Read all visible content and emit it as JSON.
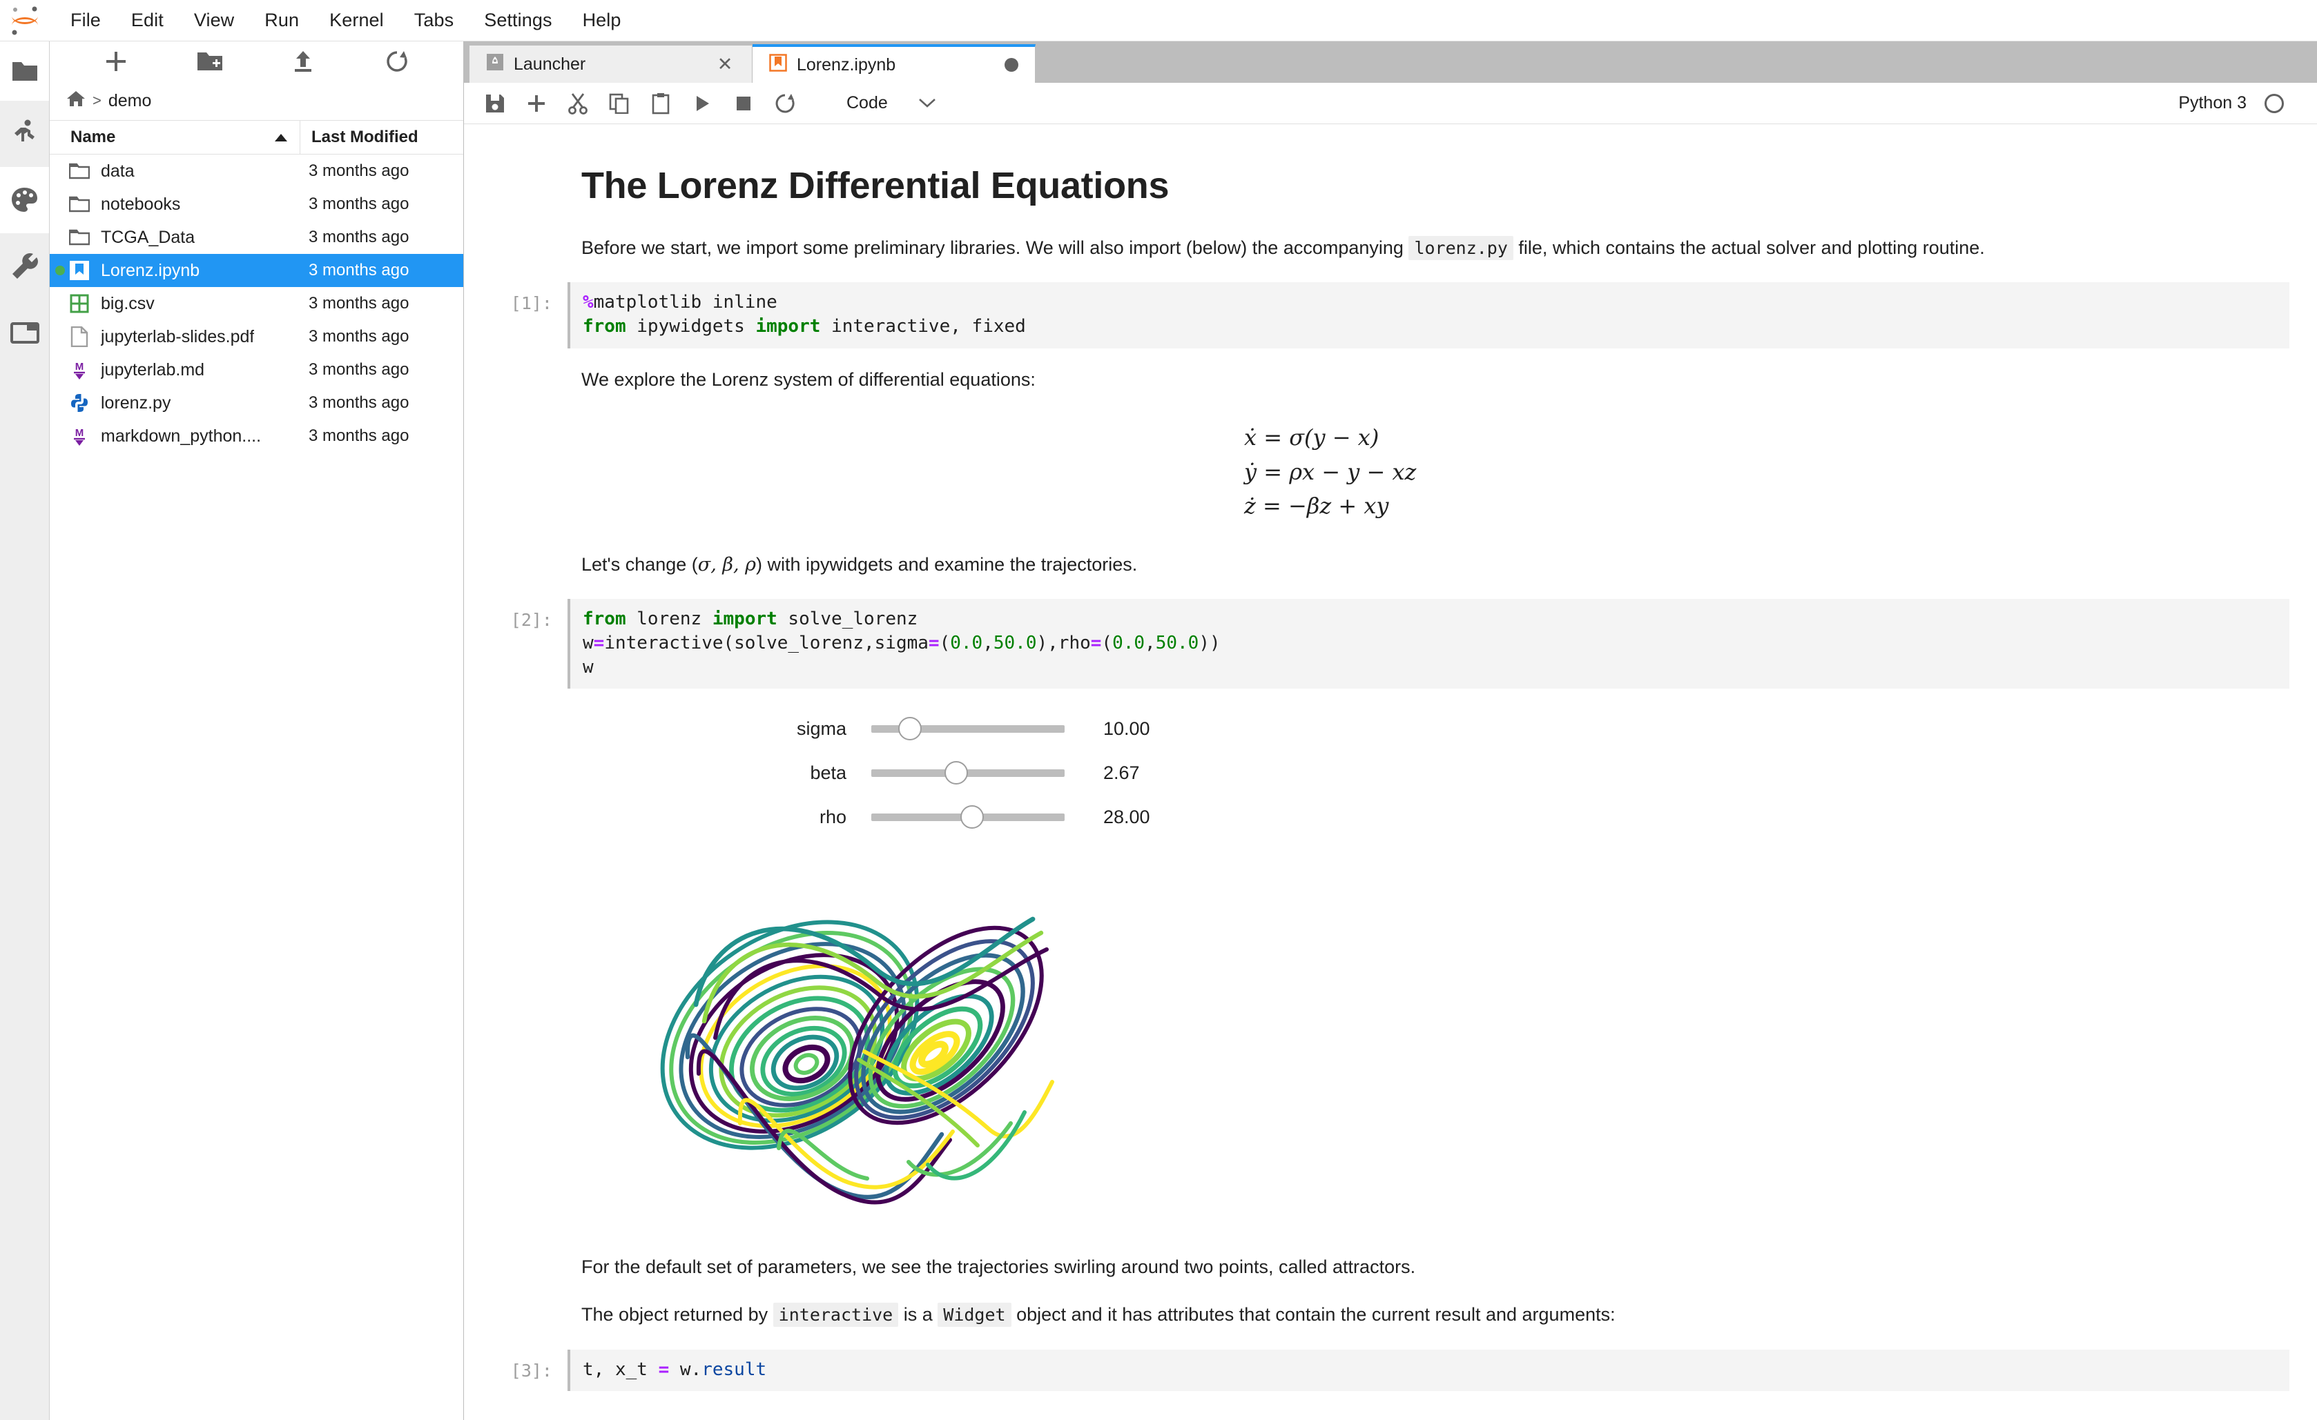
{
  "app": {
    "title": "JupyterLab",
    "logo_icon": "jupyter-logo-icon"
  },
  "menubar": {
    "items": [
      {
        "label": "File"
      },
      {
        "label": "Edit"
      },
      {
        "label": "View"
      },
      {
        "label": "Run"
      },
      {
        "label": "Kernel"
      },
      {
        "label": "Tabs"
      },
      {
        "label": "Settings"
      },
      {
        "label": "Help"
      }
    ]
  },
  "activitybar": {
    "items": [
      {
        "name": "file-browser-icon",
        "tooltip": "File Browser",
        "active": false
      },
      {
        "name": "running-sessions-icon",
        "tooltip": "Running Terminals and Kernels",
        "active": true
      },
      {
        "name": "palette-icon",
        "tooltip": "Extension Manager",
        "active": false
      },
      {
        "name": "wrench-icon",
        "tooltip": "Property Inspector",
        "active": false
      },
      {
        "name": "open-tabs-icon",
        "tooltip": "Open Tabs",
        "active": false
      }
    ]
  },
  "filebrowser": {
    "toolbar": [
      {
        "name": "new-launcher-icon",
        "label": "New Launcher"
      },
      {
        "name": "new-folder-icon",
        "label": "New Folder"
      },
      {
        "name": "upload-icon",
        "label": "Upload Files"
      },
      {
        "name": "refresh-icon",
        "label": "Refresh File List"
      }
    ],
    "breadcrumb": {
      "home_icon": "home-icon",
      "separator": ">",
      "path": "demo"
    },
    "columns": {
      "name": "Name",
      "last_modified": "Last Modified",
      "sort_direction": "ascending"
    },
    "items": [
      {
        "name": "data",
        "modified": "3 months ago",
        "icon": "folder-icon",
        "type": "folder",
        "selected": false,
        "running": false
      },
      {
        "name": "notebooks",
        "modified": "3 months ago",
        "icon": "folder-icon",
        "type": "folder",
        "selected": false,
        "running": false
      },
      {
        "name": "TCGA_Data",
        "modified": "3 months ago",
        "icon": "folder-icon",
        "type": "folder",
        "selected": false,
        "running": false
      },
      {
        "name": "Lorenz.ipynb",
        "modified": "3 months ago",
        "icon": "notebook-icon",
        "type": "notebook",
        "selected": true,
        "running": true
      },
      {
        "name": "big.csv",
        "modified": "3 months ago",
        "icon": "spreadsheet-icon",
        "type": "csv",
        "selected": false,
        "running": false
      },
      {
        "name": "jupyterlab-slides.pdf",
        "modified": "3 months ago",
        "icon": "pdf-file-icon",
        "type": "pdf",
        "selected": false,
        "running": false
      },
      {
        "name": "jupyterlab.md",
        "modified": "3 months ago",
        "icon": "markdown-icon",
        "type": "markdown",
        "selected": false,
        "running": false
      },
      {
        "name": "lorenz.py",
        "modified": "3 months ago",
        "icon": "python-icon",
        "type": "python",
        "selected": false,
        "running": false
      },
      {
        "name": "markdown_python....",
        "modified": "3 months ago",
        "icon": "markdown-icon",
        "type": "markdown",
        "selected": false,
        "running": false
      }
    ]
  },
  "dock": {
    "tabs": [
      {
        "label": "Launcher",
        "icon": "launcher-icon",
        "active": false,
        "dirty": false,
        "close_glyph": "✕"
      },
      {
        "label": "Lorenz.ipynb",
        "icon": "notebook-icon",
        "active": true,
        "dirty": true,
        "close_glyph": ""
      }
    ]
  },
  "notebook_toolbar": {
    "buttons": [
      {
        "name": "save-icon",
        "label": "Save"
      },
      {
        "name": "insert-cell-icon",
        "label": "Insert Cell Below"
      },
      {
        "name": "cut-icon",
        "label": "Cut Cells"
      },
      {
        "name": "copy-icon",
        "label": "Copy Cells"
      },
      {
        "name": "paste-icon",
        "label": "Paste Cells"
      },
      {
        "name": "run-icon",
        "label": "Run Cells"
      },
      {
        "name": "stop-icon",
        "label": "Interrupt Kernel"
      },
      {
        "name": "restart-icon",
        "label": "Restart Kernel"
      }
    ],
    "cell_type": {
      "value": "Code",
      "chevron": "chevron-down-icon"
    },
    "kernel": {
      "name": "Python 3",
      "status_icon": "kernel-idle-circle"
    }
  },
  "notebook": {
    "title": "The Lorenz Differential Equations",
    "intro": {
      "before": "Before we start, we import some preliminary libraries. We will also import (below) the accompanying ",
      "code": "lorenz.py",
      "after": " file, which contains the actual solver and plotting routine."
    },
    "cell1": {
      "prompt": "[1]:",
      "line1_magic": "%",
      "line1_rest": "matplotlib inline",
      "line2_kw1": "from",
      "line2_mid": " ipywidgets ",
      "line2_kw2": "import",
      "line2_end": " interactive, fixed"
    },
    "explore_text": "We explore the Lorenz system of differential equations:",
    "equations": [
      "ẋ = σ(y − x)",
      "ẏ = ρx − y − xz",
      "ż = −βz + xy"
    ],
    "change_text_a": "Let's change (",
    "change_params": "σ, β, ρ",
    "change_text_b": ") with ipywidgets and examine the trajectories.",
    "cell2": {
      "prompt": "[2]:",
      "l1_kw1": "from",
      "l1_mid": " lorenz ",
      "l1_kw2": "import",
      "l1_end": " solve_lorenz",
      "l2_a": "w",
      "l2_eq1": "=",
      "l2_b": "interactive(solve_lorenz,sigma",
      "l2_eq2": "=",
      "l2_c": "(",
      "l2_n1": "0.0",
      "l2_d": ",",
      "l2_n2": "50.0",
      "l2_e": "),rho",
      "l2_eq3": "=",
      "l2_f": "(",
      "l2_n3": "0.0",
      "l2_g": ",",
      "l2_n4": "50.0",
      "l2_h": "))",
      "l3": "w"
    },
    "widgets": [
      {
        "label": "sigma",
        "value": "10.00",
        "fill_pct": 20,
        "min": 0.0,
        "max": 50.0
      },
      {
        "label": "beta",
        "value": "2.67",
        "fill_pct": 44,
        "min": 0.0,
        "max": 6.0
      },
      {
        "label": "rho",
        "value": "28.00",
        "fill_pct": 52,
        "min": 0.0,
        "max": 50.0
      }
    ],
    "plot": {
      "name": "lorenz-attractor-plot",
      "colormap": "viridis",
      "description": "Lorenz attractor trajectories"
    },
    "attractor_text": "For the default set of parameters, we see the trajectories swirling around two points, called attractors.",
    "widget_text": {
      "a": "The object returned by ",
      "code1": "interactive",
      "b": " is a ",
      "code2": "Widget",
      "c": " object and it has attributes that contain the current result and arguments:"
    },
    "cell3": {
      "prompt": "[3]:",
      "pre": "t, x_t ",
      "eq": "=",
      "mid": " w.",
      "attr": "result"
    }
  },
  "colors": {
    "accent_blue": "#2196f3",
    "selection_blue": "#2196f3",
    "jupyter_orange": "#f37726",
    "keyword_green": "#008000",
    "operator_purple": "#aa22ff",
    "attribute_blue": "#0d47a1",
    "running_green": "#4caf50",
    "code_bg": "#f4f4f4",
    "inline_code_bg": "#efefef"
  }
}
